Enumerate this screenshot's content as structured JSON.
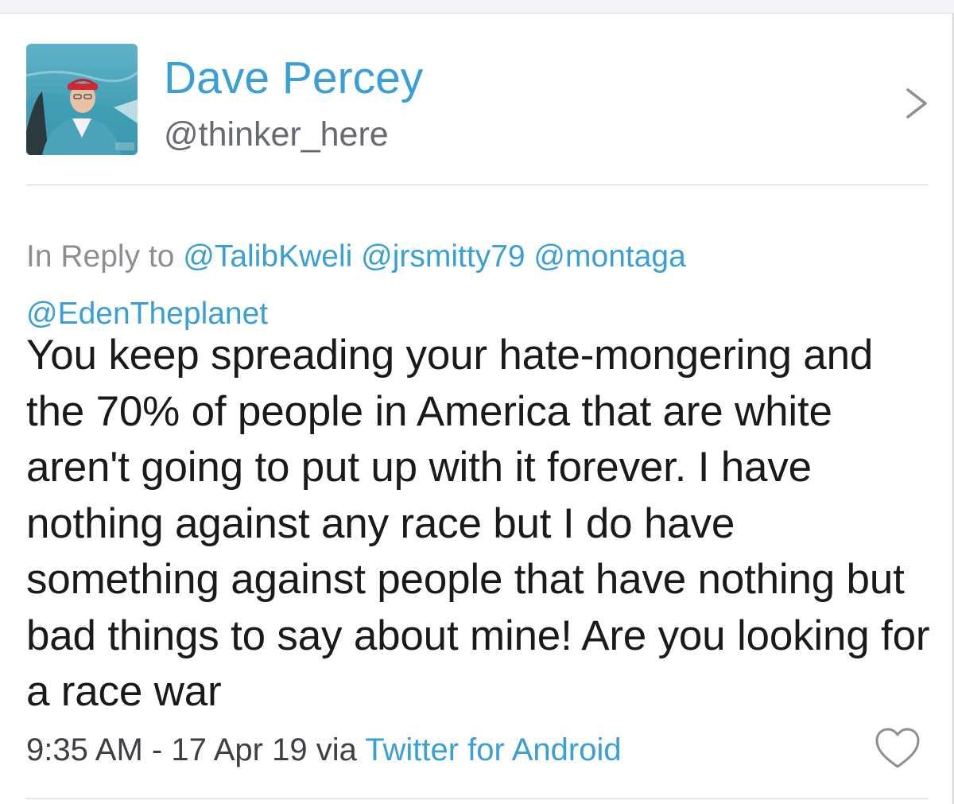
{
  "author": {
    "display_name": "Dave Percey",
    "handle": "@thinker_here",
    "avatar_icon": "profile-photo"
  },
  "reply": {
    "prefix": "In Reply to",
    "mentions": [
      "@TalibKweli",
      "@jrsmitty79",
      "@montaga",
      "@EdenTheplanet"
    ]
  },
  "tweet": {
    "text": "You keep spreading your hate-mongering and the 70% of people in America that are white aren't going to put up with it forever. I have nothing against any race but I do have something against people that have nothing but bad things to say about mine! Are you looking for a race war"
  },
  "meta": {
    "time": "9:35 AM",
    "separator": "-",
    "date": "17 Apr 19",
    "via": "via",
    "client": "Twitter for Android"
  },
  "icons": {
    "chevron": "chevron-right-icon",
    "like": "heart-outline-icon"
  },
  "colors": {
    "link": "#3a9fd6",
    "text": "#1a1a1a",
    "muted": "#8b8f94",
    "divider": "#d6d6da"
  }
}
